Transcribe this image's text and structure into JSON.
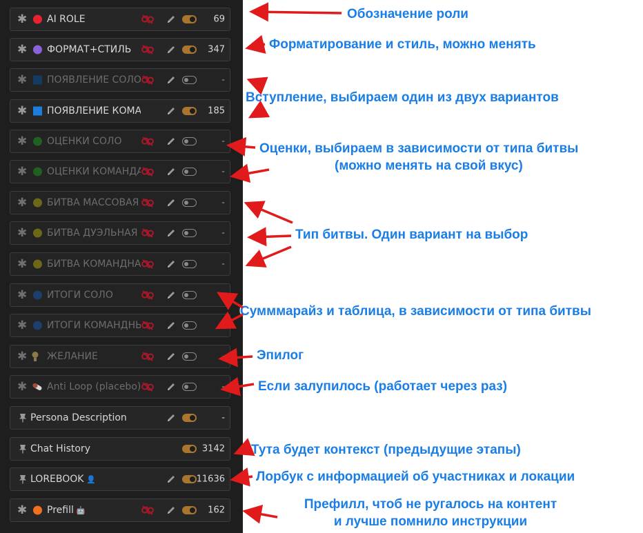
{
  "prompt_list": [
    {
      "name": "AI ROLE",
      "count": "69",
      "icon": "circle",
      "icon_color": "#e8222e",
      "enabled": true,
      "dim": false,
      "link": true,
      "edit": true,
      "pinned": false
    },
    {
      "name": "ФОРМАТ+СТИЛЬ",
      "count": "347",
      "icon": "circle",
      "icon_color": "#8a63d8",
      "enabled": true,
      "dim": false,
      "link": true,
      "edit": true,
      "pinned": false
    },
    {
      "name": "ПОЯВЛЕНИЕ СОЛО",
      "count": "-",
      "icon": "square",
      "icon_color": "#153a63",
      "enabled": false,
      "dim": true,
      "link": true,
      "edit": true,
      "pinned": false
    },
    {
      "name": "ПОЯВЛЕНИЕ КОМАНДА",
      "count": "185",
      "icon": "square",
      "icon_color": "#1c7fe0",
      "enabled": true,
      "dim": false,
      "link": false,
      "edit": true,
      "pinned": false
    },
    {
      "name": "ОЦЕНКИ СОЛО",
      "count": "-",
      "icon": "circle",
      "icon_color": "#1f7a1f",
      "enabled": false,
      "dim": true,
      "link": true,
      "edit": true,
      "pinned": false
    },
    {
      "name": "ОЦЕНКИ КОМАНДА",
      "count": "-",
      "icon": "circle",
      "icon_color": "#1f7a1f",
      "enabled": false,
      "dim": true,
      "link": true,
      "edit": true,
      "pinned": false
    },
    {
      "name": "БИТВА МАССОВАЯ",
      "count": "-",
      "icon": "circle",
      "icon_color": "#8d8414",
      "enabled": false,
      "dim": true,
      "link": true,
      "edit": true,
      "pinned": false
    },
    {
      "name": "БИТВА ДУЭЛЬНАЯ",
      "count": "-",
      "icon": "circle",
      "icon_color": "#8d8414",
      "enabled": false,
      "dim": true,
      "link": true,
      "edit": true,
      "pinned": false
    },
    {
      "name": "БИТВА КОМАНДНАЯ",
      "count": "-",
      "icon": "circle",
      "icon_color": "#8d8414",
      "enabled": false,
      "dim": true,
      "link": true,
      "edit": true,
      "pinned": false
    },
    {
      "name": "ИТОГИ СОЛО",
      "count": "-",
      "icon": "circle",
      "icon_color": "#1c4a8c",
      "enabled": false,
      "dim": true,
      "link": true,
      "edit": true,
      "pinned": false
    },
    {
      "name": "ИТОГИ КОМАНДНЫЕ",
      "count": "-",
      "icon": "circle",
      "icon_color": "#1c4a8c",
      "enabled": false,
      "dim": true,
      "link": true,
      "edit": true,
      "pinned": false
    },
    {
      "name": "ЖЕЛАНИЕ",
      "count": "-",
      "icon": "bulb",
      "icon_color": "#8d7a4a",
      "enabled": false,
      "dim": true,
      "link": true,
      "edit": true,
      "pinned": false
    },
    {
      "name": "Anti Loop (placebo)",
      "count": "-",
      "icon": "pill",
      "icon_color": "#a84a3a",
      "enabled": false,
      "dim": true,
      "link": true,
      "edit": true,
      "pinned": false
    },
    {
      "name": "Persona Description",
      "count": "-",
      "icon": "pin",
      "icon_color": "#9a9a9a",
      "enabled": true,
      "dim": false,
      "link": false,
      "edit": true,
      "pinned": true
    },
    {
      "name": "Chat History",
      "count": "3142",
      "icon": "pin",
      "icon_color": "#9a9a9a",
      "enabled": true,
      "dim": false,
      "link": false,
      "edit": false,
      "pinned": true
    },
    {
      "name": "LOREBOOK",
      "count": "11636",
      "icon": "pin",
      "icon_color": "#9a9a9a",
      "enabled": true,
      "dim": false,
      "link": false,
      "edit": true,
      "pinned": true,
      "badge": "user"
    },
    {
      "name": "Prefill",
      "count": "162",
      "icon": "circle",
      "icon_color": "#f07020",
      "enabled": true,
      "dim": false,
      "link": true,
      "edit": true,
      "pinned": false,
      "badge": "bot"
    }
  ],
  "annotations": {
    "role": "Обозначение роли",
    "format": "Форматирование и стиль, можно менять",
    "intro": "Вступление, выбираем один из двух вариантов",
    "scores_1": "Оценки, выбираем в зависимости от типа битвы",
    "scores_2": "(можно менять на свой вкус)",
    "battle_type": "Тип битвы. Один вариант на выбор",
    "summary": "Сумммарайз и таблица, в зависимости от типа битвы",
    "epilogue": "Эпилог",
    "antiloop": "Если залупилось (работает через раз)",
    "context": "Тута будет контекст (предыдущие этапы)",
    "lorebook": "Лорбук с информацией об участниках и локации",
    "prefill_1": "Префилл, чтоб не ругалось на контент",
    "prefill_2": "и лучше помнило инструкции"
  },
  "colors": {
    "annotation_text": "#1a7ee6",
    "arrow": "#e11b1b",
    "panel_bg": "#1e1e1e",
    "toggle_on": "#a9752f"
  }
}
